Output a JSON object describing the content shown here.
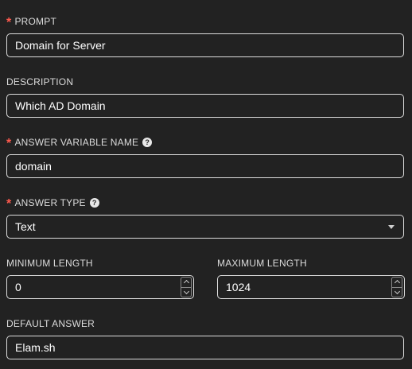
{
  "prompt": {
    "label": "PROMPT",
    "required": "*",
    "value": "Domain for Server"
  },
  "description": {
    "label": "DESCRIPTION",
    "value": "Which AD Domain"
  },
  "answer_variable_name": {
    "label": "ANSWER VARIABLE NAME",
    "required": "*",
    "help": "?",
    "value": "domain"
  },
  "answer_type": {
    "label": "ANSWER TYPE",
    "required": "*",
    "help": "?",
    "value": "Text"
  },
  "minimum_length": {
    "label": "MINIMUM LENGTH",
    "value": "0"
  },
  "maximum_length": {
    "label": "MAXIMUM LENGTH",
    "value": "1024"
  },
  "default_answer": {
    "label": "DEFAULT ANSWER",
    "value": "Elam.sh"
  },
  "colors": {
    "background": "#222222",
    "required": "#ff5a4e",
    "border": "#dcdcdc"
  },
  "icons": {
    "help": "question-circle-icon",
    "select": "caret-down-icon",
    "stepper_up": "chevron-up-icon",
    "stepper_down": "chevron-down-icon"
  }
}
